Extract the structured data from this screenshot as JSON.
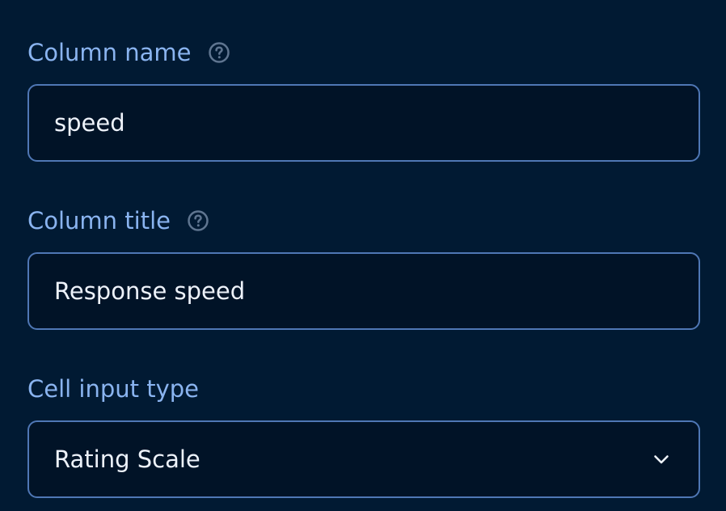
{
  "form": {
    "column_name": {
      "label": "Column name",
      "value": "speed",
      "help_icon": "question-circle-icon"
    },
    "column_title": {
      "label": "Column title",
      "value": "Response speed",
      "help_icon": "question-circle-icon"
    },
    "cell_input_type": {
      "label": "Cell input type",
      "selected": "Rating Scale",
      "dropdown_icon": "chevron-down-icon"
    }
  },
  "colors": {
    "background": "#011a33",
    "label": "#8ab4f0",
    "input_border": "#4f77b5",
    "input_background": "#011327",
    "input_text": "#edf2fa",
    "help_icon": "#5f7590"
  }
}
